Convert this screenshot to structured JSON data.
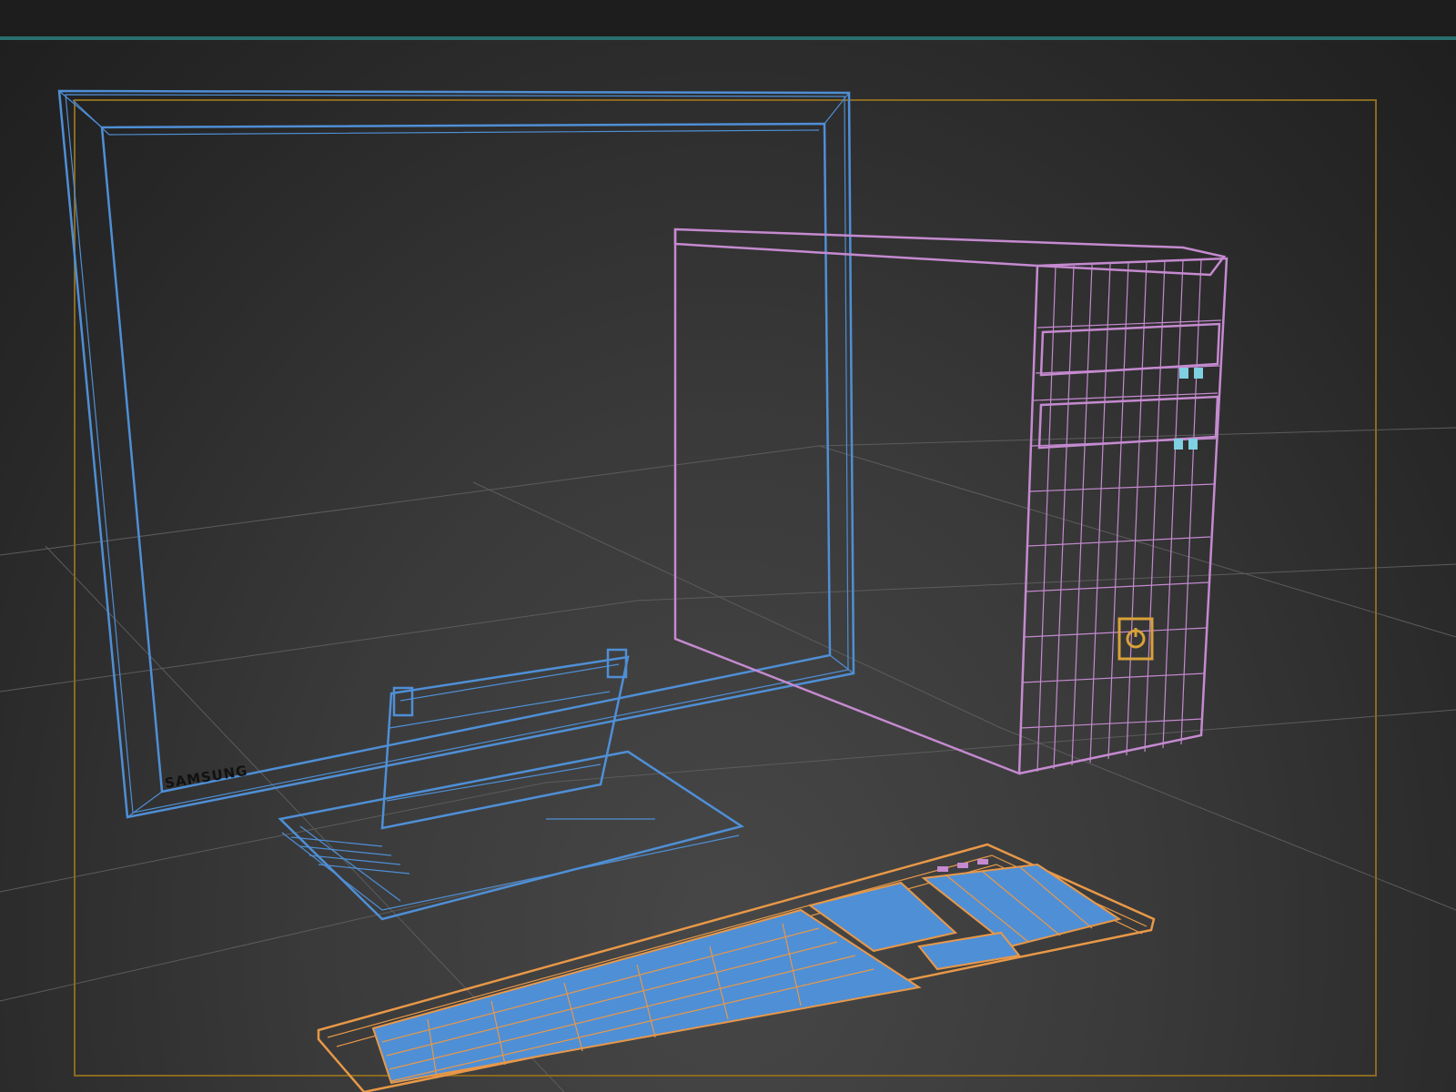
{
  "viewport": {
    "name": "3d-perspective-viewport",
    "monitor_brand_label": "SAMSUNG"
  },
  "colors": {
    "monitor_wireframe": "#4f8fd6",
    "pc_case_wireframe": "#c58ad0",
    "keyboard_wireframe": "#e89848",
    "safe_frame": "#8a6a20",
    "viewport_active_border": "#2a6f6f",
    "grid": "#5c5c5c"
  },
  "objects": [
    {
      "name": "monitor",
      "icon": "monitor-wireframe"
    },
    {
      "name": "pc-tower",
      "icon": "pc-case-wireframe"
    },
    {
      "name": "keyboard",
      "icon": "keyboard-wireframe"
    },
    {
      "name": "power-button",
      "icon": "power-icon"
    }
  ]
}
